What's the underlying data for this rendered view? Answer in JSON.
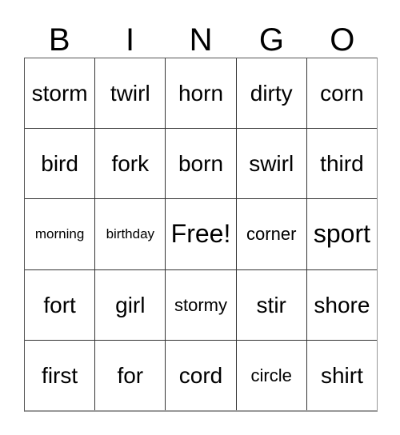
{
  "card": {
    "headers": [
      "B",
      "I",
      "N",
      "G",
      "O"
    ],
    "rows": [
      [
        {
          "text": "storm",
          "size": "md"
        },
        {
          "text": "twirl",
          "size": "md"
        },
        {
          "text": "horn",
          "size": "md"
        },
        {
          "text": "dirty",
          "size": "md"
        },
        {
          "text": "corn",
          "size": "md"
        }
      ],
      [
        {
          "text": "bird",
          "size": "md"
        },
        {
          "text": "fork",
          "size": "md"
        },
        {
          "text": "born",
          "size": "md"
        },
        {
          "text": "swirl",
          "size": "md"
        },
        {
          "text": "third",
          "size": "md"
        }
      ],
      [
        {
          "text": "morning",
          "size": "xs"
        },
        {
          "text": "birthday",
          "size": "xs"
        },
        {
          "text": "Free!",
          "size": "lg"
        },
        {
          "text": "corner",
          "size": "sm"
        },
        {
          "text": "sport",
          "size": "lg"
        }
      ],
      [
        {
          "text": "fort",
          "size": "md"
        },
        {
          "text": "girl",
          "size": "md"
        },
        {
          "text": "stormy",
          "size": "sm"
        },
        {
          "text": "stir",
          "size": "md"
        },
        {
          "text": "shore",
          "size": "md"
        }
      ],
      [
        {
          "text": "first",
          "size": "md"
        },
        {
          "text": "for",
          "size": "md"
        },
        {
          "text": "cord",
          "size": "md"
        },
        {
          "text": "circle",
          "size": "sm"
        },
        {
          "text": "shirt",
          "size": "md"
        }
      ]
    ],
    "free_space": {
      "row": 2,
      "col": 2,
      "label": "Free!"
    },
    "colors": {
      "background": "#ffffff",
      "text": "#000000",
      "grid_line": "#333333",
      "outer_border": "#999999"
    }
  }
}
